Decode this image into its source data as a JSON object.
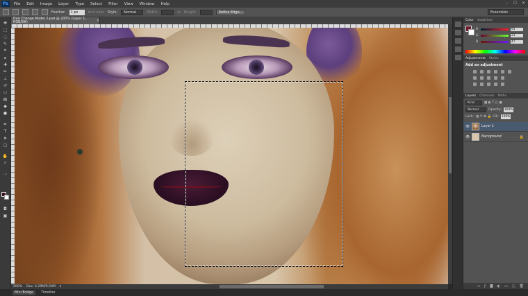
{
  "app": {
    "logo": "Ps"
  },
  "menu": [
    "File",
    "Edit",
    "Image",
    "Layer",
    "Type",
    "Select",
    "Filter",
    "View",
    "Window",
    "Help"
  ],
  "window_controls": [
    "–",
    "☐",
    "✕"
  ],
  "options": {
    "feather_label": "Feather:",
    "feather_value": "1 px",
    "anti_alias_label": "Anti-alias",
    "style_label": "Style:",
    "style_value": "Normal",
    "width_label": "Width:",
    "height_label": "Height:",
    "refine_button": "Refine Edge...",
    "workspace": "Essentials"
  },
  "document": {
    "tab_title": "Hair Change Model 2.psd @ 200% (Layer 1, RGB/8#)",
    "close": "×"
  },
  "status": {
    "zoom": "200%",
    "doc": "Doc: 4.29M/9.04M"
  },
  "bottom_tabs": [
    "Mini Bridge",
    "Timeline"
  ],
  "panels": {
    "color": {
      "tabs": [
        "Color",
        "Swatches"
      ],
      "channels": [
        {
          "label": "R",
          "value": "91"
        },
        {
          "label": "G",
          "value": "21"
        },
        {
          "label": "B",
          "value": "47"
        }
      ]
    },
    "adjustments": {
      "tabs": [
        "Adjustments",
        "Styles"
      ],
      "title": "Add an adjustment"
    },
    "layers": {
      "tabs": [
        "Layers",
        "Channels",
        "Paths"
      ],
      "kind_filter": "Kind",
      "blend_mode": "Normal",
      "opacity_label": "Opacity:",
      "opacity_value": "100%",
      "lock_label": "Lock:",
      "fill_label": "Fill:",
      "fill_value": "100%",
      "items": [
        {
          "name": "Layer 1",
          "selected": true
        },
        {
          "name": "Background",
          "selected": false
        }
      ]
    }
  },
  "colors": {
    "foreground": "#6a1b2c",
    "background": "#ffffff",
    "accent_selected_layer": "#4a5a6e"
  }
}
